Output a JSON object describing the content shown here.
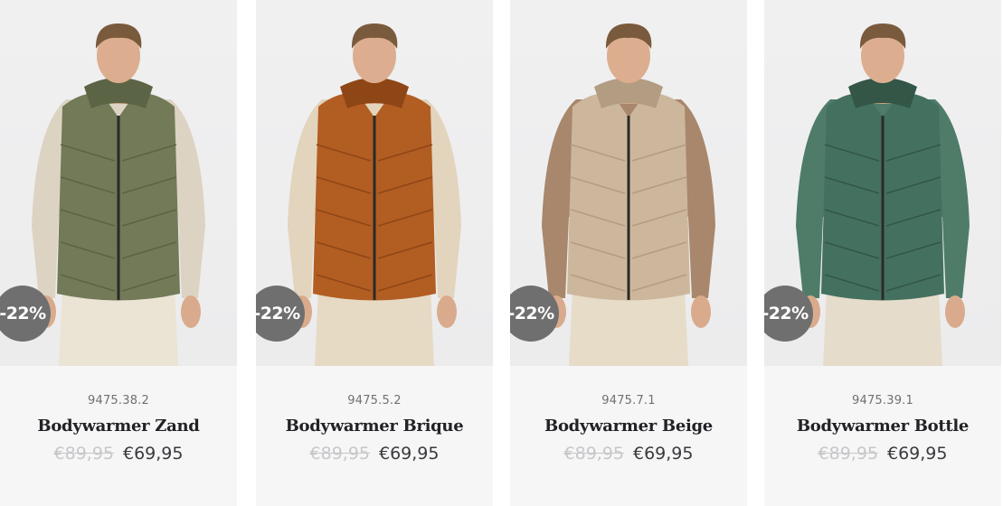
{
  "products": [
    {
      "sku": "9475.38.2",
      "title": "Bodywarmer Zand",
      "old_price": "€89,95",
      "new_price": "€69,95",
      "discount": "-22%",
      "vest_color": "#727a58",
      "vest_dark": "#5c6446",
      "sleeve_color": "#ddd3c2",
      "pants_color": "#ebe3d3"
    },
    {
      "sku": "9475.5.2",
      "title": "Bodywarmer Brique",
      "old_price": "€89,95",
      "new_price": "€69,95",
      "discount": "-22%",
      "vest_color": "#b25d22",
      "vest_dark": "#8f4616",
      "sleeve_color": "#e3d4bd",
      "pants_color": "#e6dac5"
    },
    {
      "sku": "9475.7.1",
      "title": "Bodywarmer Beige",
      "old_price": "€89,95",
      "new_price": "€69,95",
      "discount": "-22%",
      "vest_color": "#cdb79c",
      "vest_dark": "#b39d82",
      "sleeve_color": "#a8876c",
      "pants_color": "#e6dcc8"
    },
    {
      "sku": "9475.39.1",
      "title": "Bodywarmer Bottle",
      "old_price": "€89,95",
      "new_price": "€69,95",
      "discount": "-22%",
      "vest_color": "#44705f",
      "vest_dark": "#335647",
      "sleeve_color": "#4e7c69",
      "pants_color": "#e6dccb"
    }
  ]
}
